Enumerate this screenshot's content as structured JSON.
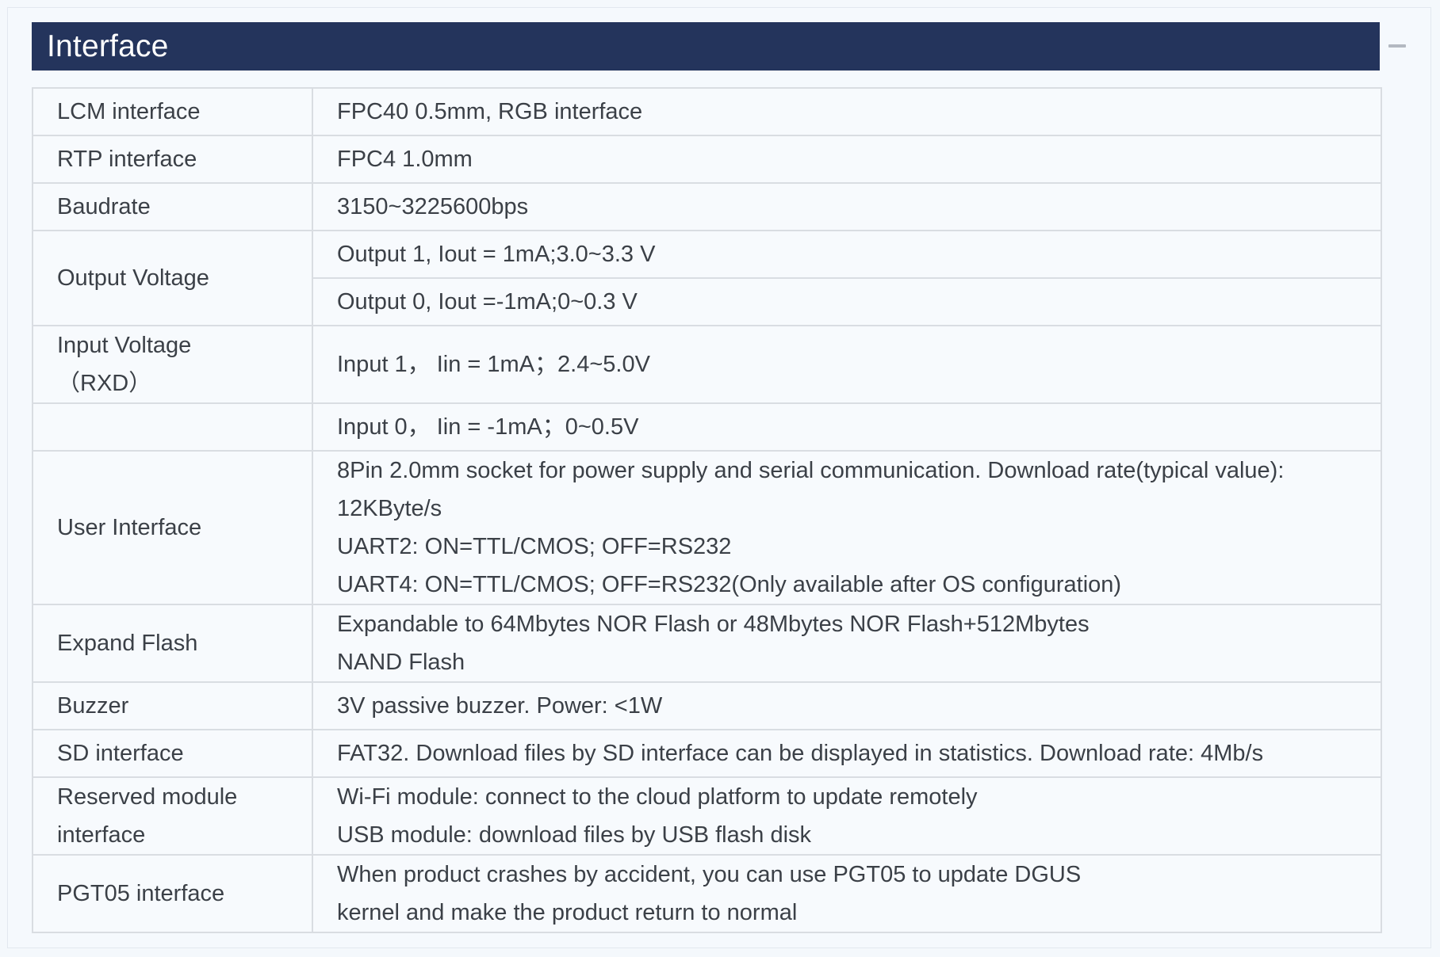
{
  "section": {
    "title": "Interface",
    "collapse_icon": "minus-icon"
  },
  "rows": [
    {
      "label": "LCM interface",
      "values": [
        "FPC40 0.5mm, RGB interface"
      ]
    },
    {
      "label": "RTP interface",
      "values": [
        "FPC4 1.0mm"
      ]
    },
    {
      "label": "Baudrate",
      "values": [
        "3150~3225600bps"
      ]
    },
    {
      "label": "Output Voltage",
      "values": [
        "Output 1, Iout = 1mA;3.0~3.3 V",
        "Output 0, Iout =-1mA;0~0.3 V"
      ]
    },
    {
      "label": "Input Voltage",
      "label_sub": "（RXD）",
      "values": [
        "Input 1，  Iin = 1mA；2.4~5.0V"
      ]
    },
    {
      "label": "",
      "values": [
        "Input 0，  Iin = -1mA；0~0.5V"
      ]
    },
    {
      "label": "User Interface",
      "values": [
        "8Pin 2.0mm socket for power supply and serial communication. Download rate(typical value):",
        "12KByte/s",
        "UART2: ON=TTL/CMOS; OFF=RS232",
        "UART4: ON=TTL/CMOS; OFF=RS232(Only available after OS configuration)"
      ]
    },
    {
      "label": "Expand Flash",
      "values": [
        "Expandable to 64Mbytes NOR Flash or 48Mbytes NOR Flash+512Mbytes",
        "NAND Flash"
      ]
    },
    {
      "label": "Buzzer",
      "values": [
        "3V passive buzzer. Power: <1W"
      ]
    },
    {
      "label": "SD interface",
      "values": [
        "FAT32. Download files by SD interface can be displayed in statistics. Download rate: 4Mb/s"
      ]
    },
    {
      "label": "Reserved module",
      "label_sub": "interface",
      "values": [
        "Wi-Fi module: connect to the cloud platform to update remotely",
        "USB module: download files by USB flash disk"
      ]
    },
    {
      "label": "PGT05 interface",
      "values": [
        "When product crashes by accident, you can use PGT05 to update DGUS",
        "kernel and make the product return to normal"
      ]
    }
  ]
}
